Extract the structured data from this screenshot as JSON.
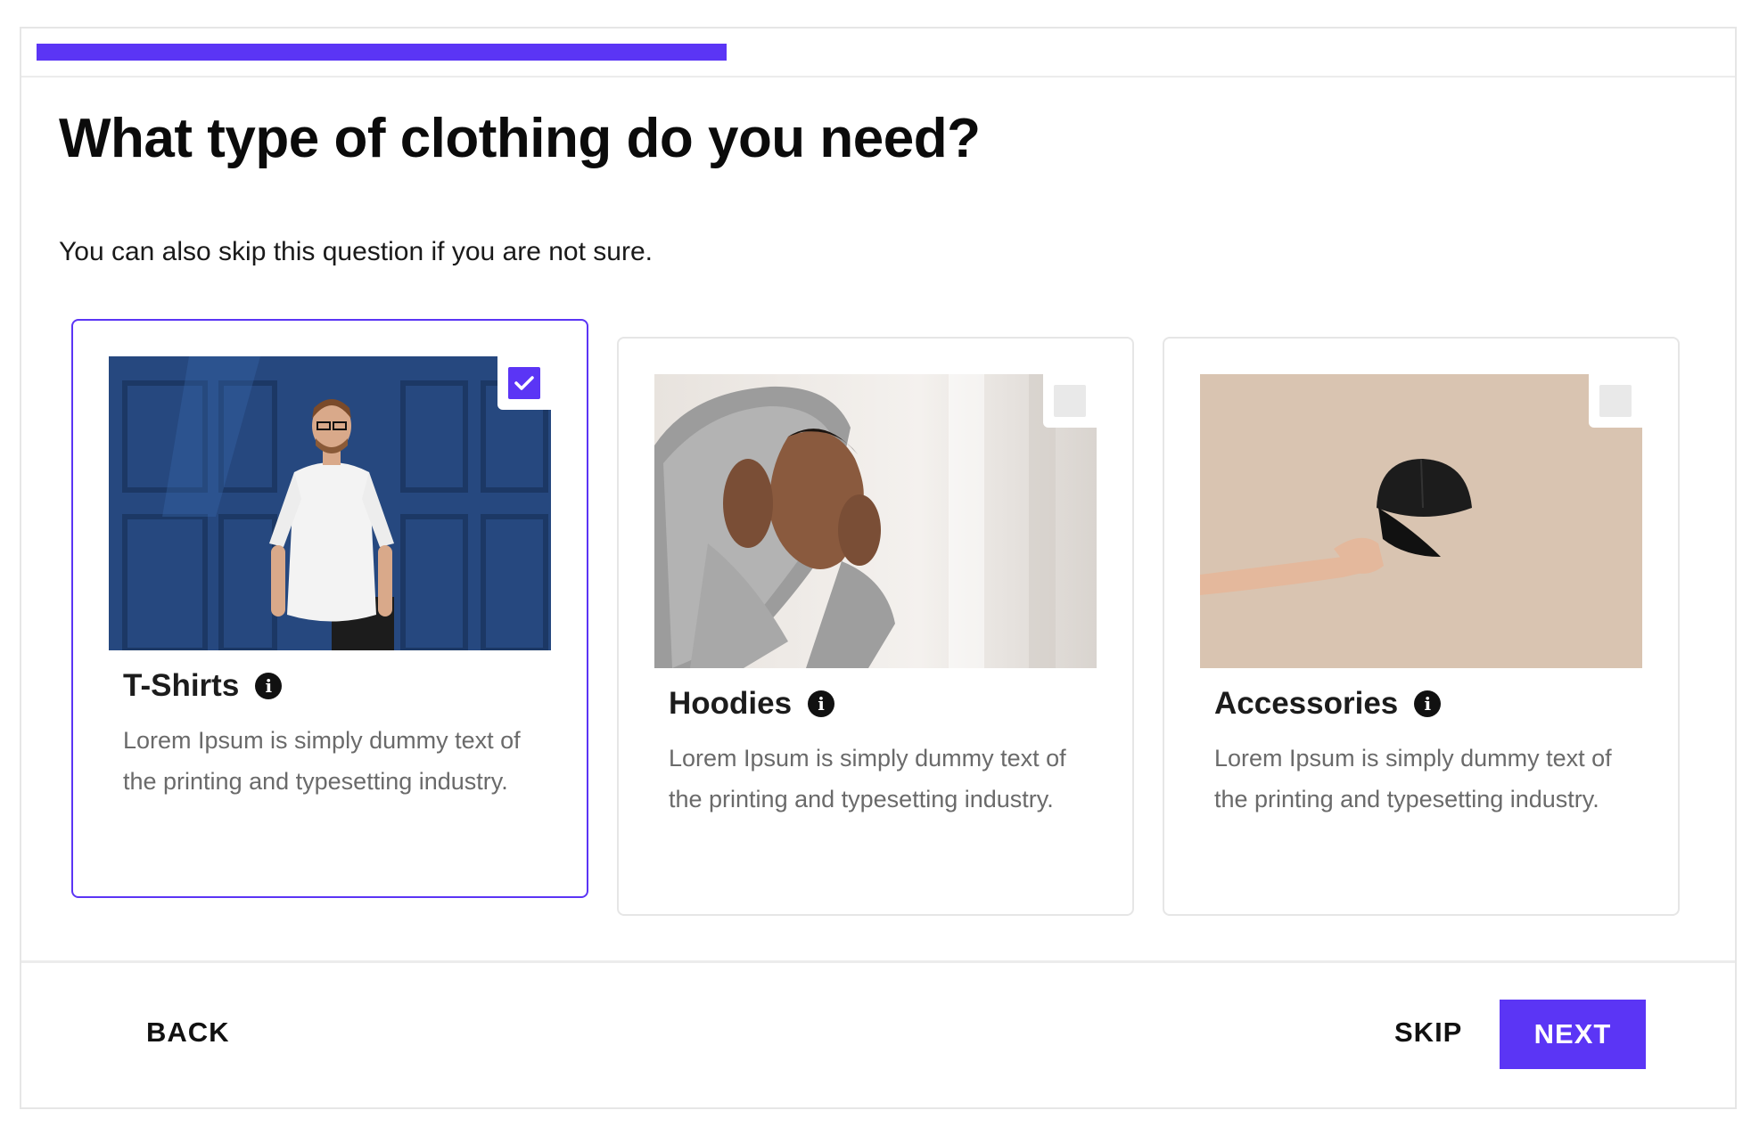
{
  "progress": {
    "value": 0.41
  },
  "question": {
    "title": "What type of clothing do you need?",
    "subtitle": "You can also skip this question if you are not sure."
  },
  "options": [
    {
      "name": "T-Shirts",
      "description": "Lorem Ipsum is simply dummy text of the printing and typesetting industry.",
      "selected": true
    },
    {
      "name": "Hoodies",
      "description": "Lorem Ipsum is simply dummy text of the printing and typesetting industry.",
      "selected": false
    },
    {
      "name": "Accessories",
      "description": "Lorem Ipsum is simply dummy text of the printing and typesetting industry.",
      "selected": false
    }
  ],
  "icons": {
    "info": "info-icon",
    "check": "checkmark-icon"
  },
  "footer": {
    "back_label": "BACK",
    "skip_label": "SKIP",
    "next_label": "NEXT"
  },
  "colors": {
    "accent": "#5b35f5",
    "border": "#e6e6e6",
    "text_muted": "#6a6a6a"
  }
}
